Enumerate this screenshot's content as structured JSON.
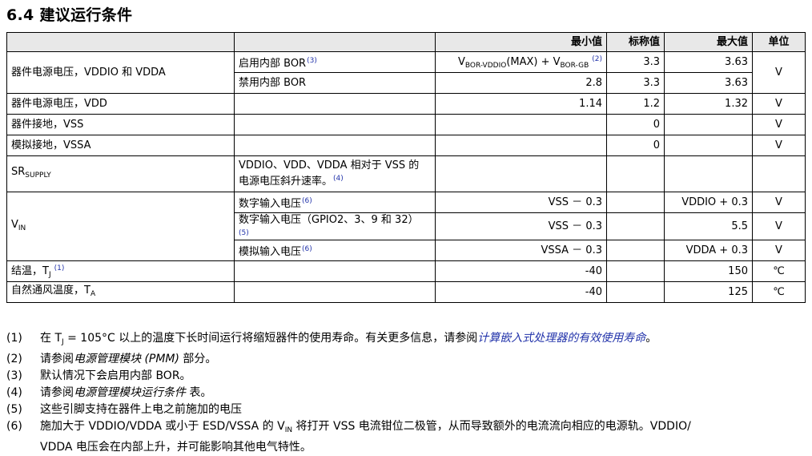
{
  "title": "6.4 建议运行条件",
  "header": {
    "min": "最小值",
    "typ": "标称值",
    "max": "最大值",
    "unit": "单位"
  },
  "rows": {
    "vddio": {
      "param": "器件电源电压，VDDIO 和 VDDA",
      "sub1": {
        "cond": "启用内部 BOR",
        "cond_note": "(3)",
        "min_v1": "V",
        "min_sub1": "BOR-VDDIO",
        "min_mid": "(MAX) + V",
        "min_sub2": "BOR-GB",
        "min_note": "(2)",
        "typ": "3.3",
        "max": "3.63"
      },
      "sub2": {
        "cond": "禁用内部 BOR",
        "min": "2.8",
        "typ": "3.3",
        "max": "3.63"
      },
      "unit": "V"
    },
    "vdd": {
      "param": "器件电源电压，VDD",
      "min": "1.14",
      "typ": "1.2",
      "max": "1.32",
      "unit": "V"
    },
    "vss": {
      "param": "器件接地，VSS",
      "typ": "0",
      "unit": "V"
    },
    "vssa": {
      "param": "模拟接地，VSSA",
      "typ": "0",
      "unit": "V"
    },
    "sr": {
      "param_main": "SR",
      "param_sub": "SUPPLY",
      "cond_line1": "VDDIO、VDD、VDDA 相对于 VSS 的",
      "cond_line2": "电源电压斜升速率。",
      "cond_note": "(4)"
    },
    "vin": {
      "param_main": "V",
      "param_sub": "IN",
      "digital": {
        "cond": "数字输入电压",
        "cond_note": "(6)",
        "min": "VSS － 0.3",
        "max": "VDDIO + 0.3",
        "unit": "V"
      },
      "gpio": {
        "cond": "数字输入电压（GPIO2、3、9 和 32）",
        "cond_note": "(5)",
        "min": "VSS － 0.3",
        "max": "5.5",
        "unit": "V"
      },
      "analog": {
        "cond": "模拟输入电压",
        "cond_note": "(6)",
        "min": "VSSA － 0.3",
        "max": "VDDA + 0.3",
        "unit": "V"
      }
    },
    "tj": {
      "param": "结温，T",
      "param_sub": "J",
      "param_note": "(1)",
      "min": "-40",
      "max": "150",
      "unit": "℃"
    },
    "ta": {
      "param": "自然通风温度，T",
      "param_sub": "A",
      "min": "-40",
      "max": "125",
      "unit": "℃"
    }
  },
  "notes": {
    "n1": {
      "idx": "(1)",
      "pre": "在 T",
      "sub": "J",
      "mid": " = 105°C 以上的温度下长时间运行将缩短器件的使用寿命。有关更多信息，请参阅",
      "link": "计算嵌入式处理器的有效使用寿命",
      "post": "。"
    },
    "n2": {
      "idx": "(2)",
      "pre": "请参阅",
      "link": "电源管理模块 (PMM)",
      "post": " 部分。"
    },
    "n3": {
      "idx": "(3)",
      "text": "默认情况下会启用内部 BOR。"
    },
    "n4": {
      "idx": "(4)",
      "pre": "请参阅",
      "link": "电源管理模块运行条件",
      "post": " 表。"
    },
    "n5": {
      "idx": "(5)",
      "text": "这些引脚支持在器件上电之前施加的电压"
    },
    "n6": {
      "idx": "(6)",
      "pre": "施加大于 VDDIO/VDDA 或小于 ESD/VSSA 的 V",
      "sub": "IN",
      "mid": " 将打开 VSS 电流钳位二极管，从而导致额外的电流流向相应的电源轨。VDDIO/",
      "line2": "VDDA 电压会在内部上升，并可能影响其他电气特性。"
    }
  }
}
